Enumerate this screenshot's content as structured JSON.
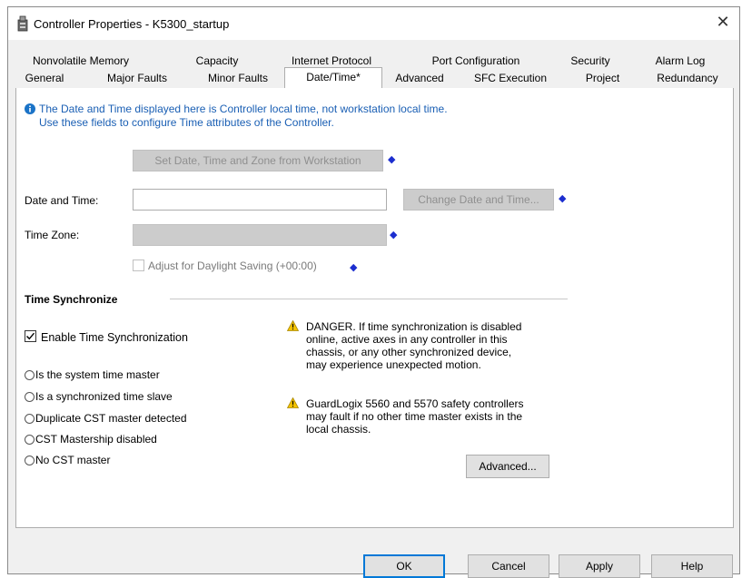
{
  "window": {
    "title": "Controller Properties - K5300_startup"
  },
  "tabs_row1": [
    "Nonvolatile Memory",
    "Capacity",
    "Internet Protocol",
    "Port Configuration",
    "Security",
    "Alarm Log"
  ],
  "tabs_row2": [
    "General",
    "Major Faults",
    "Minor Faults",
    "Date/Time*",
    "Advanced",
    "SFC Execution",
    "Project",
    "Redundancy"
  ],
  "info": {
    "line1": "The Date and Time displayed here is Controller local time, not workstation local time.",
    "line2": "Use these fields to configure Time attributes of the Controller."
  },
  "set_from_workstation_label": "Set Date, Time and Zone from Workstation",
  "date_time": {
    "label": "Date and Time:",
    "value": "",
    "change_label": "Change Date and Time..."
  },
  "time_zone": {
    "label": "Time Zone:",
    "value": ""
  },
  "daylight_label": "Adjust for Daylight Saving (+00:00)",
  "time_sync": {
    "heading": "Time Synchronize",
    "enable_label": "Enable Time Synchronization",
    "enable_checked": true,
    "status_options": [
      "Is the system time master",
      "Is a synchronized time slave",
      "Duplicate CST master detected",
      "CST Mastership disabled",
      "No CST master"
    ]
  },
  "warnings": {
    "danger_lines": [
      "DANGER. If time synchronization is disabled",
      "online, active axes in any controller in this",
      "chassis, or any other synchronized device,",
      "may experience unexpected motion."
    ],
    "guardlogix_lines": [
      "GuardLogix 5560 and 5570 safety controllers",
      "may fault if no other time master exists in the",
      "local chassis."
    ]
  },
  "advanced_button": "Advanced...",
  "footer": {
    "ok": "OK",
    "cancel": "Cancel",
    "apply": "Apply",
    "help": "Help"
  },
  "colors": {
    "info_text": "#1a5fb4",
    "arrow": "#1c2ecf",
    "warning": "#f5c400",
    "focus": "#0078d7"
  },
  "icons": {
    "title": "controller-icon",
    "info": "info-icon",
    "warning": "warning-icon",
    "close": "close-icon",
    "arrow": "arrow-left-icon"
  }
}
